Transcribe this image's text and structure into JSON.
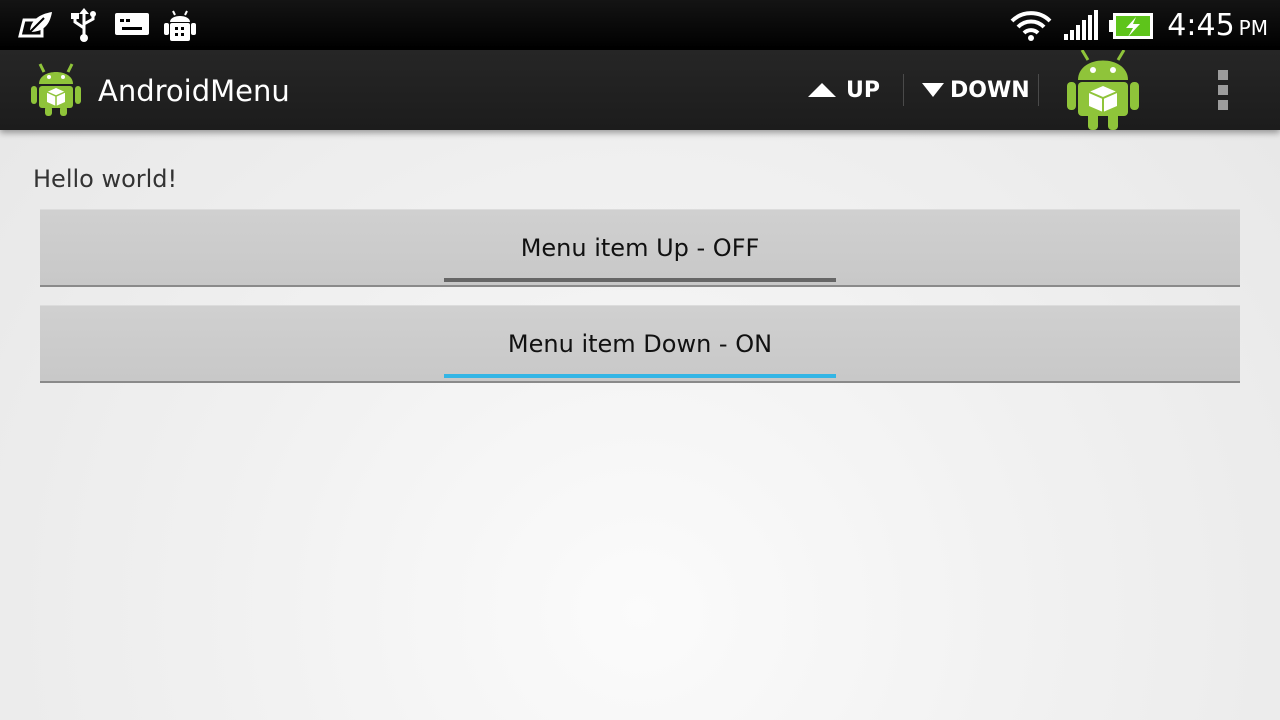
{
  "status_bar": {
    "time": "4:45",
    "ampm": "PM",
    "left_icons": [
      "leaf-icon",
      "usb-icon",
      "keyboard-icon",
      "android-debug-icon"
    ],
    "right_icons": [
      "wifi-icon",
      "signal-icon",
      "battery-charging-icon"
    ]
  },
  "action_bar": {
    "title": "AndroidMenu",
    "actions": [
      {
        "label": "UP",
        "icon": "triangle-up-icon"
      },
      {
        "label": "DOWN",
        "icon": "triangle-down-icon"
      }
    ],
    "overflow_icon": "overflow-menu-icon"
  },
  "content": {
    "greeting": "Hello world!",
    "toggles": [
      {
        "label": "Menu item Up - OFF",
        "state": "off",
        "indicator_color": "#666666"
      },
      {
        "label": "Menu item Down - ON",
        "state": "on",
        "indicator_color": "#33b5e5"
      }
    ]
  }
}
